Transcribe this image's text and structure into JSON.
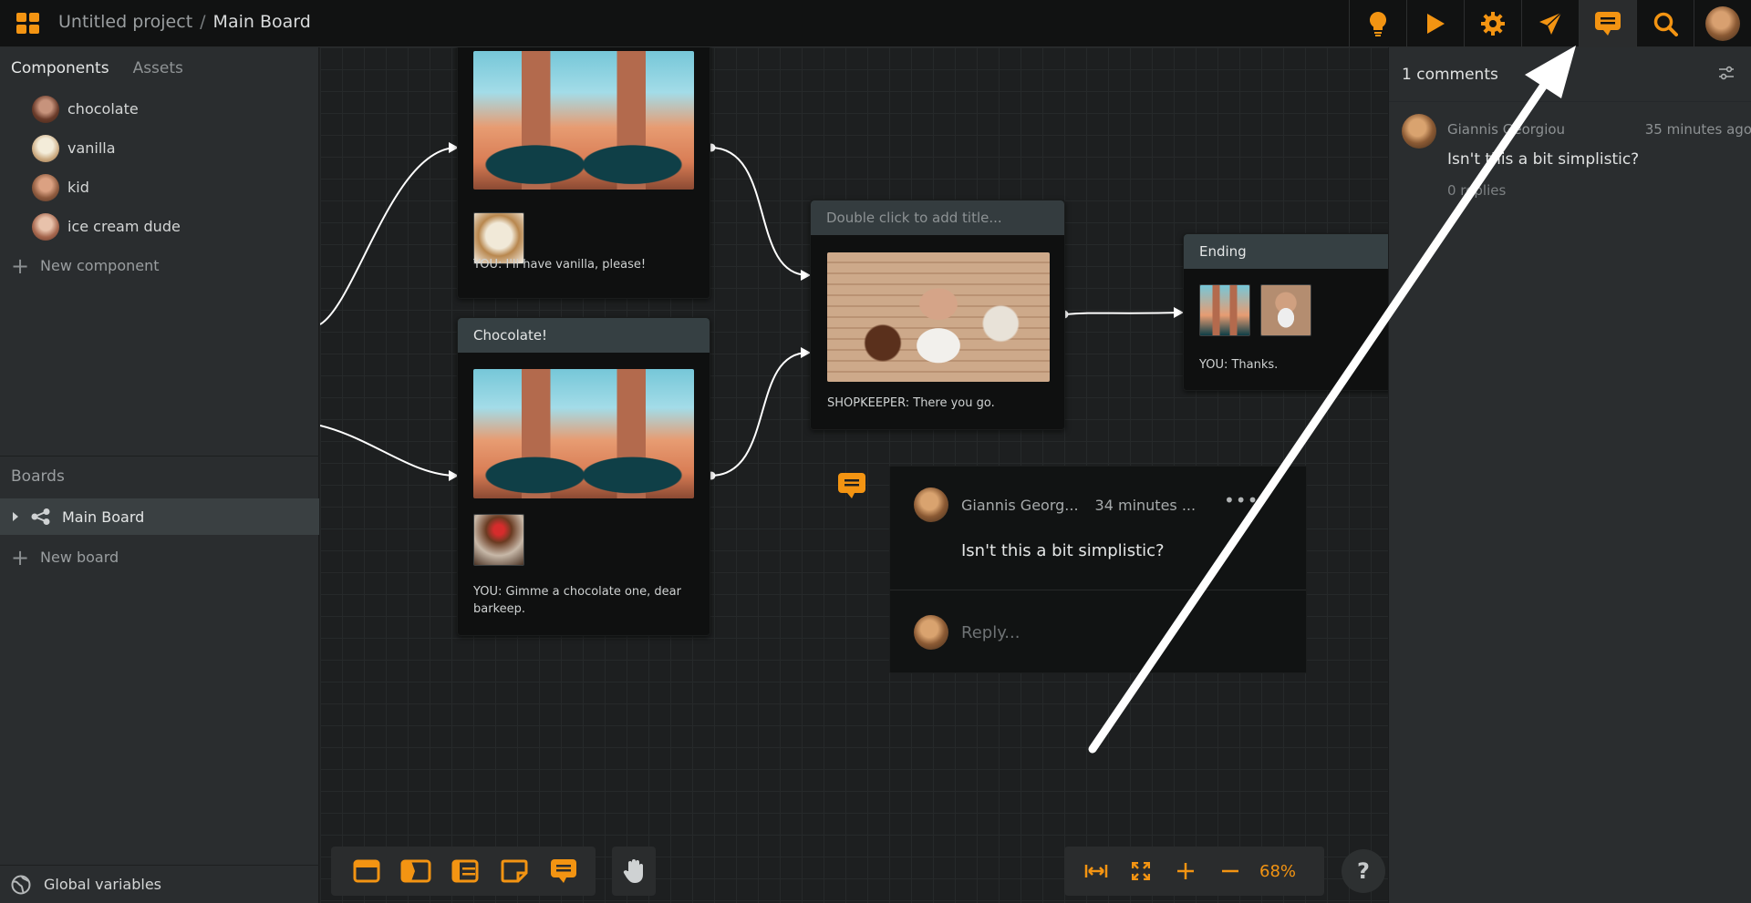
{
  "header": {
    "project": "Untitled project",
    "separator": "/",
    "board": "Main Board",
    "tools": [
      "bulb-icon",
      "play-icon",
      "gear-icon",
      "send-icon",
      "comment-icon",
      "search-icon",
      "user-avatar"
    ]
  },
  "sidebar": {
    "tabs": [
      "Components",
      "Assets"
    ],
    "components": [
      {
        "label": "chocolate",
        "color": "#8a4b3a"
      },
      {
        "label": "vanilla",
        "color": "#e9d7b8"
      },
      {
        "label": "kid",
        "color": "#c68a66"
      },
      {
        "label": "ice cream dude",
        "color": "#b7745a"
      }
    ],
    "new_component": "New component",
    "boards_heading": "Boards",
    "boards": [
      "Main Board"
    ],
    "new_board": "New board",
    "global_variables": "Global variables"
  },
  "canvas": {
    "node1": {
      "text": "YOU: I'll have vanilla, please!"
    },
    "node2": {
      "title": "Chocolate!",
      "text": "YOU: Gimme a chocolate one, dear barkeep."
    },
    "node3": {
      "title": "Double click to add title...",
      "text": "SHOPKEEPER: There you go."
    },
    "node4": {
      "title": "Ending",
      "text": "YOU: Thanks."
    },
    "thread": {
      "author": "Giannis Georg...",
      "time": "34 minutes ...",
      "message": "Isn't this a bit simplistic?",
      "reply_placeholder": "Reply..."
    },
    "zoom": "68%",
    "help": "?"
  },
  "right_panel": {
    "count": "1 comments",
    "comment": {
      "author": "Giannis Georgiou",
      "time": "35 minutes ago",
      "text": "Isn't this a bit simplistic?",
      "replies": "0 replies"
    }
  },
  "colors": {
    "accent": "#f39412",
    "panel": "#2a2d2f",
    "canvas": "#1d1f20"
  }
}
